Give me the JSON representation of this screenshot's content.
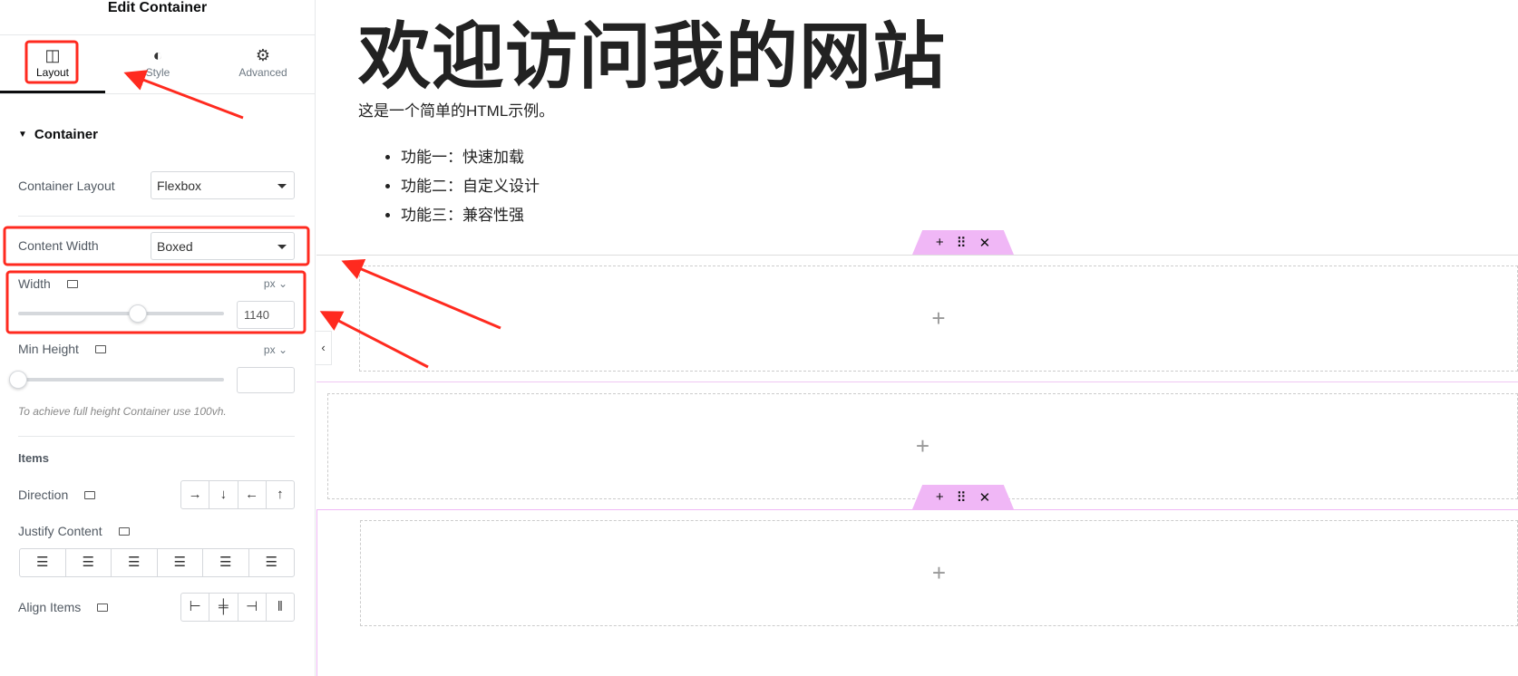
{
  "panel": {
    "title": "Edit Container",
    "tabs": [
      {
        "label": "Layout",
        "icon": "columns-icon"
      },
      {
        "label": "Style",
        "icon": "half-circle-icon"
      },
      {
        "label": "Advanced",
        "icon": "gear-icon"
      }
    ],
    "section": "Container",
    "container_layout": {
      "label": "Container Layout",
      "value": "Flexbox"
    },
    "content_width": {
      "label": "Content Width",
      "value": "Boxed"
    },
    "width": {
      "label": "Width",
      "unit": "px",
      "value": "1140",
      "slider_fraction": 0.58
    },
    "min_height": {
      "label": "Min Height",
      "unit": "px",
      "value": "",
      "hint": "To achieve full height Container use 100vh."
    },
    "items": "Items",
    "direction": {
      "label": "Direction",
      "options": [
        "→",
        "↓",
        "←",
        "↑"
      ]
    },
    "justify": {
      "label": "Justify Content"
    },
    "align": {
      "label": "Align Items"
    }
  },
  "page": {
    "heading": "欢迎访问我的网站",
    "paragraph": "这是一个简单的HTML示例。",
    "list": [
      "功能一：快速加载",
      "功能二：自定义设计",
      "功能三：兼容性强"
    ]
  },
  "handle": {
    "add": "+",
    "drag": "⠿",
    "close": "✕"
  },
  "plus": "+",
  "colors": {
    "annotation": "#ff2a1f",
    "handle": "#f0b7f6"
  }
}
